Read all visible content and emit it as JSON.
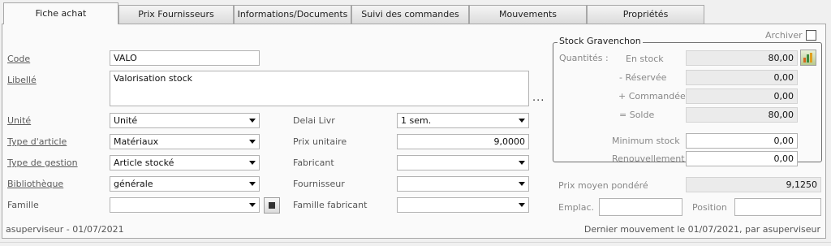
{
  "tabs": [
    {
      "label": "Fiche achat"
    },
    {
      "label": "Prix Fournisseurs"
    },
    {
      "label": "Informations/Documents"
    },
    {
      "label": "Suivi des commandes"
    },
    {
      "label": "Mouvements"
    },
    {
      "label": "Propriétés"
    }
  ],
  "archive": {
    "label": "Archiver"
  },
  "fields": {
    "code": {
      "label": "Code",
      "value": "VALO"
    },
    "libelle": {
      "label": "Libellé",
      "value": "Valorisation stock"
    },
    "more": "...",
    "unite": {
      "label": "Unité",
      "value": "Unité"
    },
    "type_article": {
      "label": "Type d'article",
      "value": "Matériaux"
    },
    "type_gestion": {
      "label": "Type de gestion",
      "value": "Article stocké"
    },
    "bibliotheque": {
      "label": "Bibliothèque",
      "value": "générale"
    },
    "famille": {
      "label": "Famille",
      "value": ""
    },
    "delai_livr": {
      "label": "Delai Livr",
      "value": "1 sem."
    },
    "prix_unitaire": {
      "label": "Prix unitaire",
      "value": "9,0000"
    },
    "fabricant": {
      "label": "Fabricant",
      "value": ""
    },
    "fournisseur": {
      "label": "Fournisseur",
      "value": ""
    },
    "famille_fabricant": {
      "label": "Famille fabricant",
      "value": ""
    }
  },
  "stock": {
    "title": "Stock Gravenchon",
    "quantites_label": "Quantités :",
    "en_stock": {
      "label": "En stock",
      "value": "80,00"
    },
    "reservee": {
      "label": "- Réservée",
      "value": "0,00"
    },
    "commandee": {
      "label": "+ Commandée",
      "value": "0,00"
    },
    "solde": {
      "label": "= Solde",
      "value": "80,00"
    },
    "minimum": {
      "label": "Minimum stock",
      "value": "0,00"
    },
    "renouvellement": {
      "label": "Renouvellement",
      "value": "0,00"
    },
    "prix_moyen": {
      "label": "Prix moyen pondéré",
      "value": "9,1250"
    },
    "emplac": {
      "label": "Emplac.",
      "value": ""
    },
    "position": {
      "label": "Position",
      "value": ""
    }
  },
  "footer": {
    "left": "asuperviseur - 01/07/2021",
    "right": "Dernier mouvement le 01/07/2021, par asuperviseur"
  }
}
